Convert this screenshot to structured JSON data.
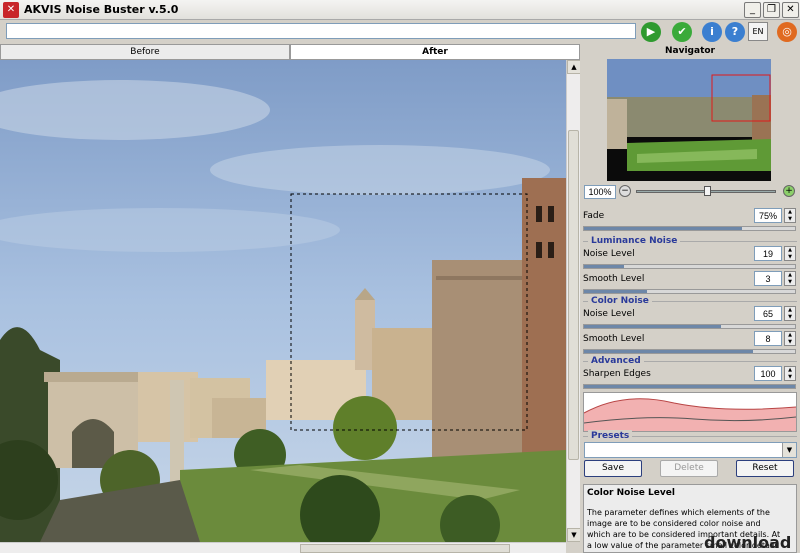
{
  "window": {
    "title": "AKVIS Noise Buster v.5.0",
    "minimize": "_",
    "restore": "❐",
    "close": "✕"
  },
  "toolbar": {
    "path_value": "",
    "run": "▶",
    "apply": "✔",
    "info": "i",
    "help": "?",
    "lang": "EN",
    "prefs": "◎"
  },
  "tabs": [
    {
      "label": "Before"
    },
    {
      "label": "After"
    }
  ],
  "navigator": {
    "title": "Navigator",
    "zoom": "100%",
    "zoom_out": "−",
    "zoom_in": "+"
  },
  "params": {
    "fade": {
      "label": "Fade",
      "value": "75%",
      "level": 0.75
    },
    "luminance": {
      "title": "Luminance Noise",
      "noise": {
        "label": "Noise Level",
        "value": "19",
        "level": 0.19
      },
      "smooth": {
        "label": "Smooth Level",
        "value": "3",
        "level": 0.3
      }
    },
    "color": {
      "title": "Color Noise",
      "noise": {
        "label": "Noise Level",
        "value": "65",
        "level": 0.65
      },
      "smooth": {
        "label": "Smooth Level",
        "value": "8",
        "level": 0.8
      }
    },
    "advanced": {
      "title": "Advanced",
      "sharpen": {
        "label": "Sharpen Edges",
        "value": "100",
        "level": 1.0
      }
    }
  },
  "presets": {
    "title": "Presets",
    "selected": "",
    "save": "Save",
    "delete": "Delete",
    "reset": "Reset"
  },
  "help": {
    "title": "Color Noise Level",
    "text": "The parameter defines which elements of the image are to be considered color noise and which are to be considered important details. At a low value of the parameter small color details ca"
  },
  "watermark": "download"
}
